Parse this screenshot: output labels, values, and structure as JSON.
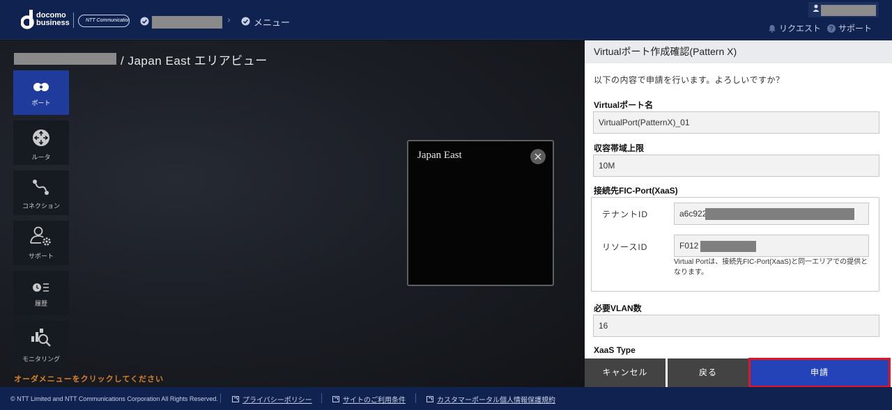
{
  "header": {
    "logo_docomo": "docomo",
    "logo_business": "business",
    "ntt_logo": "NTT Communications",
    "crumb_menu": "メニュー",
    "request_link": "リクエスト",
    "support_link": "サポート"
  },
  "main": {
    "title": "/ Japan East エリアビュー",
    "hint": "オーダメニューをクリックしてください"
  },
  "sidebar": {
    "items": [
      {
        "label": "ポート",
        "icon": "port-icon",
        "active": true
      },
      {
        "label": "ルータ",
        "icon": "router-icon",
        "active": false
      },
      {
        "label": "コネクション",
        "icon": "connection-icon",
        "active": false
      },
      {
        "label": "サポート",
        "icon": "support-user-icon",
        "active": false
      },
      {
        "label": "履歴",
        "icon": "history-icon",
        "active": false
      },
      {
        "label": "モニタリング",
        "icon": "monitoring-icon",
        "active": false
      }
    ]
  },
  "area_box": {
    "title": "Japan East"
  },
  "panel": {
    "title": "Virtualポート作成確認(Pattern X)",
    "intro": "以下の内容で申請を行います。よろしいですか？",
    "fields": {
      "port_name_label": "Virtualポート名",
      "port_name_value": "VirtualPort(PatternX)_01",
      "bandwidth_label": "収容帯域上限",
      "bandwidth_value": "10M",
      "dest_label": "接続先FIC-Port(XaaS)",
      "tenant_label": "テナントID",
      "tenant_value": "a6c922",
      "resource_label": "リソースID",
      "resource_value": "F012",
      "note": "Virtual Portは、接続先FIC-Port(XaaS)と同一エリアでの提供となります。",
      "vlan_label": "必要VLAN数",
      "vlan_value": "16",
      "xaas_type_label": "XaaS Type"
    },
    "buttons": {
      "cancel": "キャンセル",
      "back": "戻る",
      "submit": "申請"
    }
  },
  "footer": {
    "copyright": "© NTT Limited and NTT Communications Corporation All Rights Reserved.",
    "links": [
      "プライバシーポリシー",
      "サイトのご利用条件",
      "カスタマーポータル個人情報保護規約"
    ]
  },
  "colors": {
    "header_bg": "#0f2250",
    "active_nav": "#1f3c9c",
    "submit_button": "#2543b8",
    "highlight_border": "#e3141c",
    "hint_text": "#d8832a"
  }
}
